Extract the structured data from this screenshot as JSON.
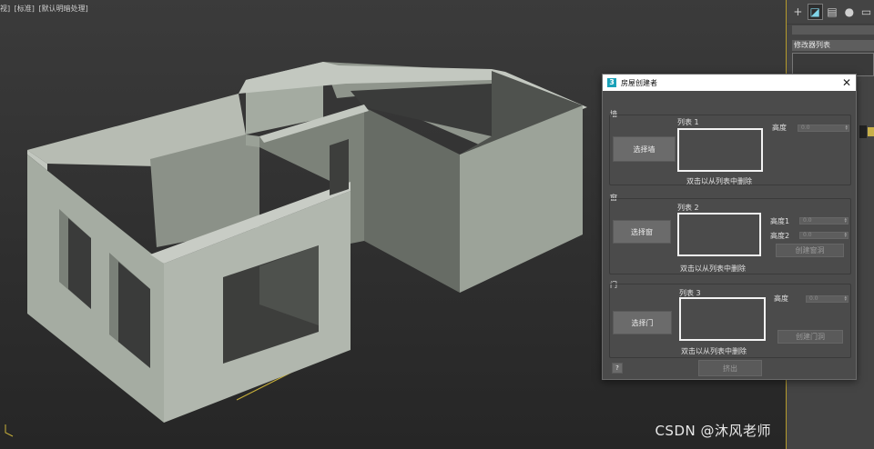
{
  "viewport": {
    "labels": [
      "[+]",
      "[透视]",
      "[标准]",
      "[默认明暗处理]"
    ],
    "visible_labels": [
      "视]",
      "[标准]",
      "[默认明暗处理]"
    ]
  },
  "command_panel": {
    "tabs": [
      {
        "icon": "create-icon",
        "glyph": "+"
      },
      {
        "icon": "modify-icon",
        "glyph": "◪"
      },
      {
        "icon": "hierarchy-icon",
        "glyph": "▤"
      },
      {
        "icon": "motion-icon",
        "glyph": "●"
      },
      {
        "icon": "display-icon",
        "glyph": "▭"
      }
    ],
    "modifier_list_label": "修改器列表"
  },
  "dialog": {
    "title": "房屋创建者",
    "app_icon": "3",
    "close_glyph": "✕",
    "wall_group": {
      "title": "墙",
      "list_caption": "列表 1",
      "select_button": "选择墙",
      "height_label": "高度",
      "height_value": "0.0",
      "hint": "双击以从列表中删除"
    },
    "window_group": {
      "title": "窗",
      "list_caption": "列表 2",
      "select_button": "选择窗",
      "height1_label": "高度1",
      "height1_value": "0.0",
      "height2_label": "高度2",
      "height2_value": "0.0",
      "create_button": "创建窗洞",
      "hint": "双击以从列表中删除"
    },
    "door_group": {
      "title": "门",
      "list_caption": "列表 3",
      "select_button": "选择门",
      "height_label": "高度",
      "height_value": "0.0",
      "create_button": "创建门洞",
      "hint": "双击以从列表中删除"
    },
    "help_label": "?",
    "extrude_button": "挤出"
  },
  "watermark": "CSDN @沐风老师",
  "colors": {
    "wall_top": "#b4bab1",
    "wall_light": "#9fa69c",
    "wall_dark": "#6f746d",
    "accent": "#1aa1b8",
    "frame": "#b59a2c"
  }
}
